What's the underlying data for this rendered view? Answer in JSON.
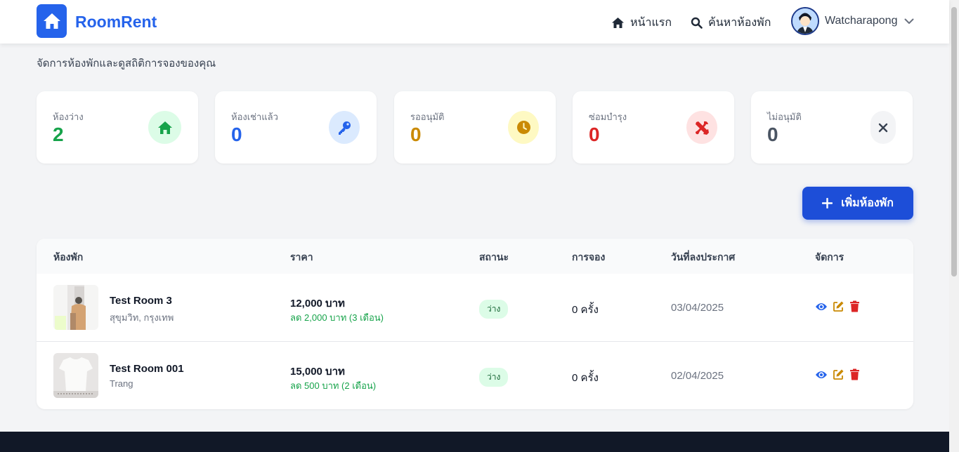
{
  "brand": {
    "name": "RoomRent",
    "icon": "house-icon",
    "color": "#2563eb"
  },
  "nav": {
    "home": {
      "label": "หน้าแรก",
      "icon": "home-icon"
    },
    "search": {
      "label": "ค้นหาห้องพัก",
      "icon": "search-icon"
    },
    "user": {
      "name": "Watcharapong",
      "icon": "chevron-down-icon"
    }
  },
  "page": {
    "subtitle": "จัดการห้องพักและดูสถิติการจองของคุณ"
  },
  "stats": [
    {
      "label": "ห้องว่าง",
      "value": "2",
      "color": "#16a34a",
      "bg": "#dcfce7",
      "icon": "home-icon"
    },
    {
      "label": "ห้องเช่าแล้ว",
      "value": "0",
      "color": "#2563eb",
      "bg": "#dbeafe",
      "icon": "key-icon"
    },
    {
      "label": "รออนุมัติ",
      "value": "0",
      "color": "#ca8a04",
      "bg": "#fef9c3",
      "icon": "clock-icon"
    },
    {
      "label": "ซ่อมบำรุง",
      "value": "0",
      "color": "#dc2626",
      "bg": "#fee2e2",
      "icon": "tools-icon"
    },
    {
      "label": "ไม่อนุมัติ",
      "value": "0",
      "color": "#4b5563",
      "bg": "#f3f4f6",
      "icon": "close-icon"
    }
  ],
  "add_button": {
    "label": "เพิ่มห้องพัก",
    "icon": "plus-icon"
  },
  "table": {
    "headers": [
      "ห้องพัก",
      "ราคา",
      "สถานะ",
      "การจอง",
      "วันที่ลงประกาศ",
      "จัดการ"
    ],
    "rows": [
      {
        "name": "Test Room 3",
        "location": "สุขุมวิท, กรุงเทพ",
        "price": "12,000 บาท",
        "discount": "ลด 2,000 บาท (3 เดือน)",
        "status": "ว่าง",
        "bookings": "0 ครั้ง",
        "date": "03/04/2025"
      },
      {
        "name": "Test Room 001",
        "location": "Trang",
        "price": "15,000 บาท",
        "discount": "ลด 500 บาท (2 เดือน)",
        "status": "ว่าง",
        "bookings": "0 ครั้ง",
        "date": "02/04/2025"
      }
    ],
    "action_icons": [
      "eye-icon",
      "edit-icon",
      "trash-icon"
    ]
  }
}
